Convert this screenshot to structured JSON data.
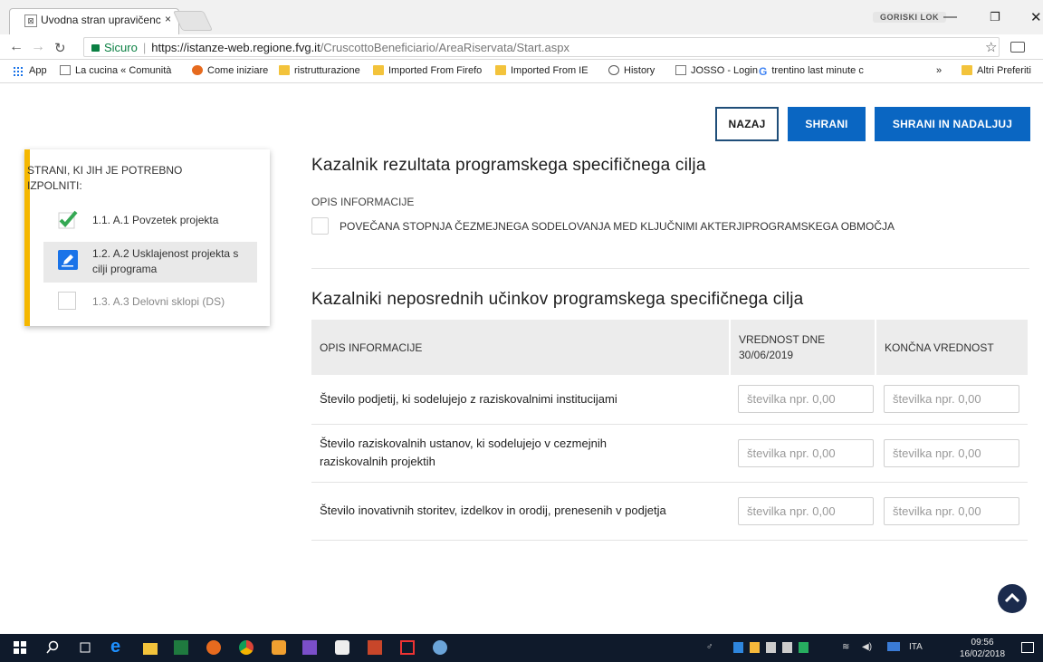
{
  "browser": {
    "tab_title": "Uvodna stran upravičenc",
    "tab_close": "×",
    "profile": "GORISKI LOK",
    "win_minimize": "—",
    "win_maximize": "❐",
    "win_close": "✕",
    "secure_label": "Sicuro",
    "url_domain": "https://istanze-web.regione.fvg.it",
    "url_path": "/CruscottoBeneficiario/AreaRiservata/Start.aspx",
    "bookmarks": [
      "App",
      "La cucina « Comunità",
      "Come iniziare",
      "ristrutturazione",
      "Imported From Firefo",
      "Imported From IE",
      "History",
      "JOSSO - Login",
      "trentino last minute c"
    ],
    "bookmarks_more": "»",
    "bookmarks_other": "Altri Preferiti"
  },
  "actions": {
    "back": "NAZAJ",
    "save": "SHRANI",
    "save_continue": "SHRANI IN NADALJUJ"
  },
  "sidebar": {
    "title": "STRANI, KI JIH JE POTREBNO IZPOLNITI:",
    "items": [
      {
        "label": "1.1. A.1 Povzetek projekta"
      },
      {
        "label": "1.2. A.2 Usklajenost projekta s cilji programa"
      },
      {
        "label": "1.3. A.3 Delovni sklopi (DS)"
      }
    ]
  },
  "result_indicator": {
    "heading": "Kazalnik rezultata programskega specifičnega cilja",
    "info_label": "OPIS INFORMACIJE",
    "option": "POVEČANA STOPNJA ČEZMEJNEGA SODELOVANJA MED KLJUČNIMI AKTERJIPROGRAMSKEGA OBMOČJA"
  },
  "output_indicators": {
    "heading": "Kazalniki neposrednih učinkov programskega specifičnega cilja",
    "columns": [
      "OPIS INFORMACIJE",
      "VREDNOST DNE 30/06/2019",
      "KONČNA VREDNOST"
    ],
    "placeholder": "številka npr. 0,00",
    "rows": [
      {
        "label": "Število podjetij, ki sodelujejo z raziskovalnimi institucijami"
      },
      {
        "label": "Število raziskovalnih ustanov, ki sodelujejo v cezmejnih raziskovalnih projektih"
      },
      {
        "label": "Število inovativnih storitev, izdelkov in orodij, prenesenih v podjetja"
      }
    ]
  },
  "taskbar": {
    "language": "ITA",
    "time": "09:56",
    "date": "16/02/2018"
  },
  "colors": {
    "primary": "#0a66c2",
    "sidebar_accent": "#f5b700",
    "check_green": "#34a853",
    "taskbar_bg": "#0f1a2b"
  }
}
